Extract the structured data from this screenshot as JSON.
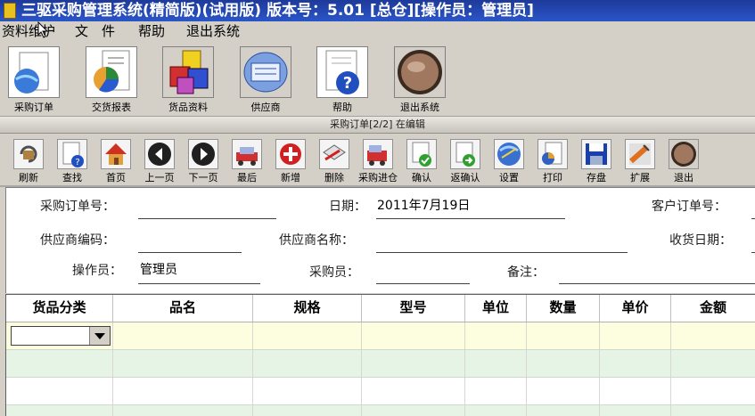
{
  "window": {
    "title": "三驱采购管理系统(精简版)(试用版)  版本号：5.01  [总仓][操作员：管理员]"
  },
  "menu": [
    "资料维护",
    "文　件",
    "帮助",
    "退出系统"
  ],
  "main_toolbar": [
    {
      "label": "采购订单",
      "icon": "globe-document-icon"
    },
    {
      "label": "交货报表",
      "icon": "pie-chart-report-icon"
    },
    {
      "label": "货品资料",
      "icon": "colored-cubes-icon"
    },
    {
      "label": "供应商",
      "icon": "window-panel-icon"
    },
    {
      "label": "帮助",
      "icon": "help-question-icon"
    },
    {
      "label": "退出系统",
      "icon": "exit-round-button-icon"
    }
  ],
  "panel": {
    "title": "采购订单[2/2]  在编辑"
  },
  "record_toolbar": [
    {
      "label": "刷新",
      "icon": "refresh-icon"
    },
    {
      "label": "查找",
      "icon": "find-icon"
    },
    {
      "label": "首页",
      "icon": "home-icon"
    },
    {
      "label": "上一页",
      "icon": "previous-icon"
    },
    {
      "label": "下一页",
      "icon": "next-icon"
    },
    {
      "label": "最后",
      "icon": "last-icon"
    },
    {
      "label": "新增",
      "icon": "add-icon"
    },
    {
      "label": "删除",
      "icon": "delete-icon"
    },
    {
      "label": "采购进仓",
      "icon": "stock-in-icon"
    },
    {
      "label": "确认",
      "icon": "confirm-icon"
    },
    {
      "label": "返确认",
      "icon": "unconfirm-icon"
    },
    {
      "label": "设置",
      "icon": "settings-icon"
    },
    {
      "label": "打印",
      "icon": "print-icon"
    },
    {
      "label": "存盘",
      "icon": "save-disk-icon"
    },
    {
      "label": "扩展",
      "icon": "extend-icon"
    },
    {
      "label": "退出",
      "icon": "exit-icon"
    }
  ],
  "form": {
    "po_number_label": "采购订单号：",
    "po_number_value": "",
    "date_label": "日期：",
    "date_value": "2011年7月19日",
    "customer_order_label": "客户订单号：",
    "customer_order_value": "",
    "supplier_code_label": "供应商编码：",
    "supplier_code_value": "",
    "supplier_name_label": "供应商名称：",
    "supplier_name_value": "",
    "receive_date_label": "收货日期：",
    "receive_date_value": "",
    "operator_label": "操作员：",
    "operator_value": "管理员",
    "buyer_label": "采购员：",
    "buyer_value": "",
    "remark_label": "备注：",
    "remark_value": ""
  },
  "grid": {
    "columns": [
      "货品分类",
      "品名",
      "规格",
      "型号",
      "单位",
      "数量",
      "单价",
      "金额"
    ],
    "rows": 4
  },
  "colors": {
    "titlebar": "#1e3a9a",
    "row_yellow": "#fdfde0",
    "row_green": "#e6f4e6"
  }
}
